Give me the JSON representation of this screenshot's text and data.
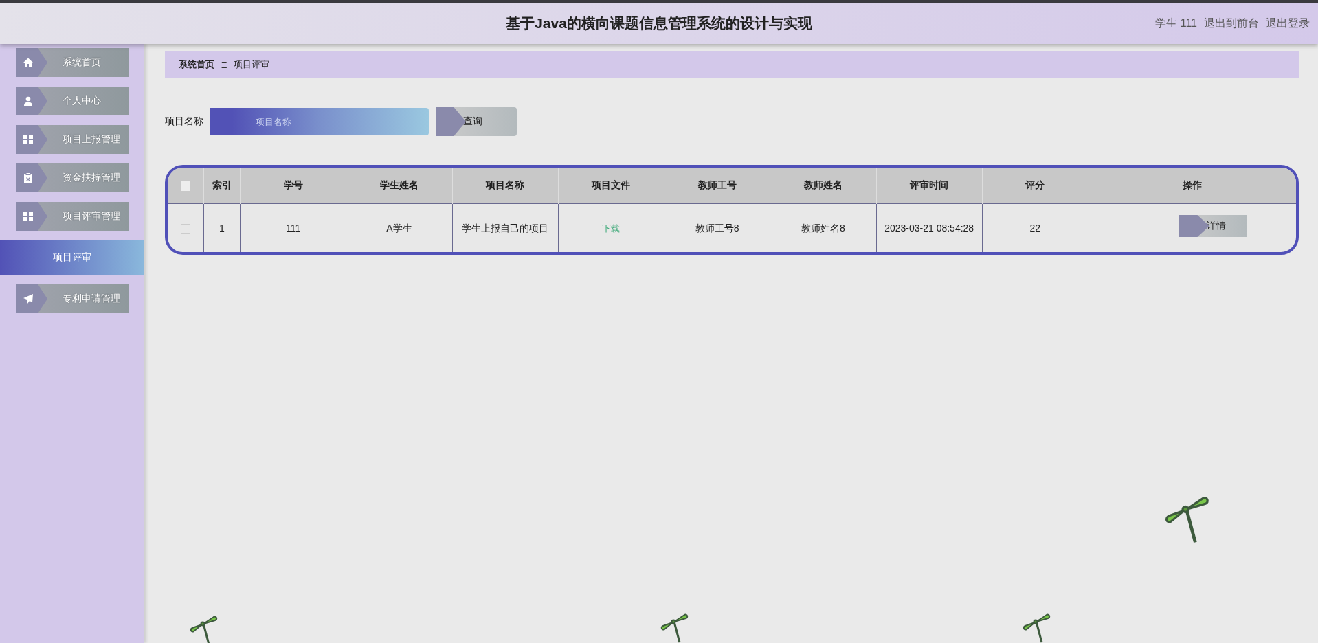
{
  "header": {
    "title": "基于Java的横向课题信息管理系统的设计与实现",
    "user": "学生 111",
    "links": [
      "退出到前台",
      "退出登录"
    ]
  },
  "sidebar": {
    "items": [
      {
        "label": "系统首页",
        "kind": "menu",
        "selected": false
      },
      {
        "label": "个人中心",
        "kind": "menu",
        "selected": false
      },
      {
        "label": "项目上报管理",
        "kind": "menu",
        "selected": false
      },
      {
        "label": "资金扶持管理",
        "kind": "menu",
        "selected": false
      },
      {
        "label": "项目评审管理",
        "kind": "menu",
        "selected": false
      },
      {
        "label": "项目评审",
        "kind": "child",
        "selected": true
      },
      {
        "label": "专利申请管理",
        "kind": "menu",
        "selected": false
      }
    ]
  },
  "breadcrumb": {
    "items": [
      "系统首页",
      "项目评审"
    ],
    "separator": "Ξ"
  },
  "search": {
    "label": "项目名称",
    "placeholder": "项目名称",
    "button": "查询"
  },
  "table": {
    "header_checkbox": {
      "checked": false
    },
    "columns": [
      "索引",
      "学号",
      "学生姓名",
      "项目名称",
      "项目文件",
      "教师工号",
      "教师姓名",
      "评审时间",
      "评分",
      "操作"
    ],
    "rows": [
      {
        "checked": false,
        "cells": [
          {
            "kind": "text",
            "text": "1"
          },
          {
            "kind": "text",
            "text": "111"
          },
          {
            "kind": "text",
            "text": "A学生"
          },
          {
            "kind": "text",
            "text": "学生上报自己的项目"
          },
          {
            "kind": "link",
            "text": "下载"
          },
          {
            "kind": "text",
            "text": "教师工号8"
          },
          {
            "kind": "text",
            "text": "教师姓名8"
          },
          {
            "kind": "text",
            "text": "2023-03-21 08:54:28"
          },
          {
            "kind": "text",
            "text": "22"
          },
          {
            "kind": "button",
            "text": "详情"
          }
        ]
      }
    ]
  }
}
